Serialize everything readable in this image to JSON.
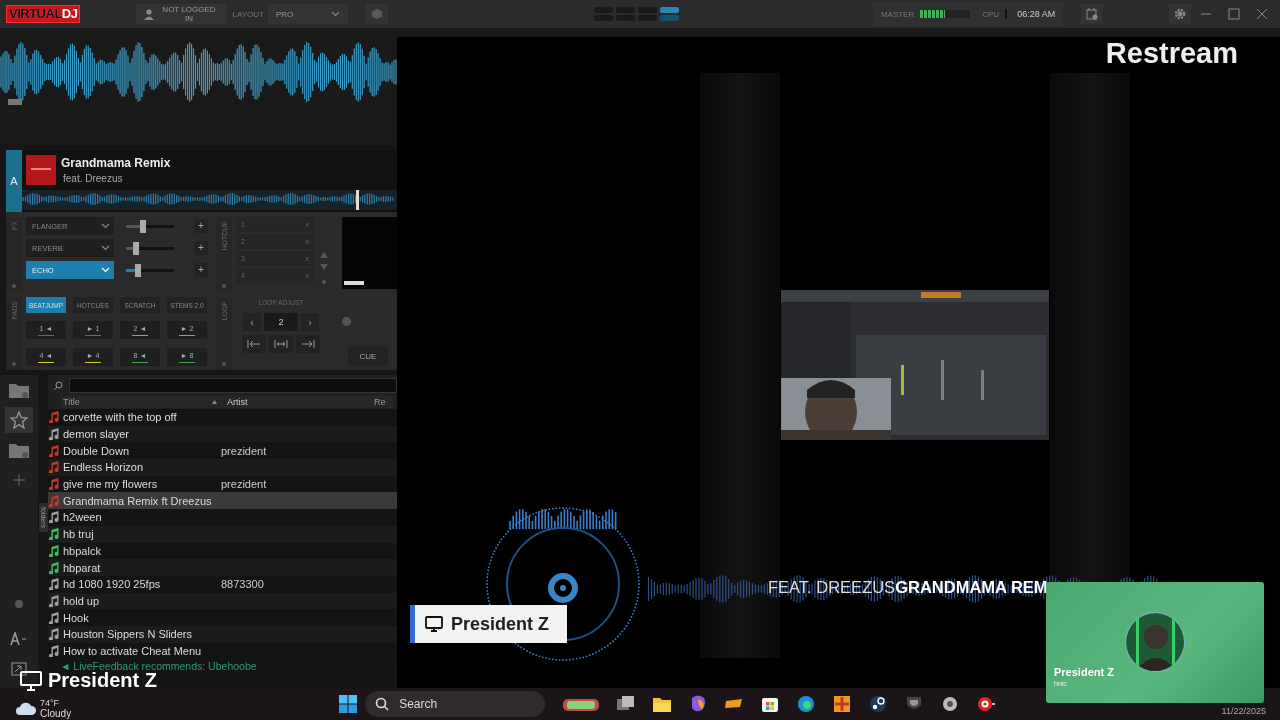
{
  "title_bar": {
    "logo": [
      "VIRTUAL",
      "DJ"
    ],
    "user": "NOT LOGGED IN",
    "layout_label": "LAYOUT",
    "layout_value": "PRO",
    "master_label": "MASTER",
    "master_meter": {
      "level": 0.5
    },
    "cpu_label": "CPU",
    "clock": "06:28 AM"
  },
  "layout_presets": [
    {
      "selected": false
    },
    {
      "selected": false
    },
    {
      "selected": false
    },
    {
      "selected": true
    }
  ],
  "deck": {
    "letter": "A",
    "title": "Grandmama Remix",
    "artist": "feat. Dreezus",
    "playhead": {
      "level": 0.89
    },
    "fx_label": "FX",
    "effects": [
      {
        "name": "FLANGER",
        "selected": false,
        "level": 0.35,
        "add": "+"
      },
      {
        "name": "REVERB",
        "selected": false,
        "level": 0.2,
        "add": "+"
      },
      {
        "name": "ECHO",
        "selected": true,
        "level": 0.25,
        "add": "+"
      }
    ],
    "hotcue_label": "HOTCUE",
    "hotcues": [
      {
        "number": "1",
        "clear": "x"
      },
      {
        "number": "2",
        "clear": "x"
      },
      {
        "number": "3",
        "clear": "x"
      },
      {
        "number": "4",
        "clear": "x"
      }
    ],
    "pads_label": "PADS",
    "pad_modes": [
      {
        "label": "BEATJUMP",
        "selected": true
      },
      {
        "label": "HOTCUES",
        "selected": false
      },
      {
        "label": "SCRATCH",
        "selected": false
      },
      {
        "label": "STEMS 2.0",
        "selected": false
      }
    ],
    "pads": [
      {
        "label": "1 ◄",
        "color": "#d83a3a"
      },
      {
        "label": "► 1",
        "color": "#d83a3a"
      },
      {
        "label": "2 ◄",
        "color": "#e0882a"
      },
      {
        "label": "► 2",
        "color": "#e0882a"
      },
      {
        "label": "4 ◄",
        "color": "#d8c43a"
      },
      {
        "label": "► 4",
        "color": "#d8c43a"
      },
      {
        "label": "8 ◄",
        "color": "#3aa84a"
      },
      {
        "label": "► 8",
        "color": "#3aa84a"
      }
    ],
    "loop_label": "LOOP",
    "loop_adjust": "LOOP ADJUST",
    "loop_prev": "‹",
    "loop_size": "2",
    "loop_next": "›",
    "cue": "CUE"
  },
  "browser": {
    "folders_tab": "folders",
    "columns": [
      "Title",
      "Artist"
    ],
    "column_3": "Re",
    "rows": [
      {
        "title": "corvette with the top off",
        "color": "#c0392b",
        "selected": false
      },
      {
        "title": "demon slayer",
        "color": "#a0a0a0",
        "selected": false
      },
      {
        "title": "Double Down",
        "artist": "prezident",
        "color": "#c0392b",
        "selected": false
      },
      {
        "title": "Endless Horizon",
        "color": "#c0392b",
        "selected": false
      },
      {
        "title": "give me my flowers",
        "artist": "prezident",
        "color": "#c0392b",
        "selected": false
      },
      {
        "title": "Grandmama Remix ft Dreezus",
        "color": "#c0392b",
        "selected": true
      },
      {
        "title": "h2ween",
        "color": "#a0a0a0",
        "selected": false
      },
      {
        "title": "hb truj",
        "color": "#3fbf5f",
        "selected": false
      },
      {
        "title": "hbpalck",
        "color": "#3fbf5f",
        "selected": false
      },
      {
        "title": "hbparat",
        "color": "#3fbf5f",
        "selected": false
      },
      {
        "title": "hd 1080 1920 25fps",
        "artist": "8873300",
        "color": "#a0a0a0",
        "selected": false
      },
      {
        "title": "hold up",
        "color": "#a0a0a0",
        "selected": false
      },
      {
        "title": "Hook",
        "color": "#a0a0a0",
        "selected": false
      },
      {
        "title": "Houston Sippers N Sliders",
        "color": "#a0a0a0",
        "selected": false
      },
      {
        "title": "How to activate Cheat Menu",
        "color": "#a0a0a0",
        "selected": false
      }
    ],
    "feedback": "◄ LiveFeedback recommends: Ubehoobe"
  },
  "stream": {
    "brand": "Restream",
    "name_tag": "President Z",
    "feat": "FEAT. DREEZUS",
    "song": "GRANDMAMA REM",
    "guest": {
      "name": "President Z",
      "subtitle": "hnic"
    }
  },
  "screen_label": "President Z",
  "taskbar": {
    "temperature": "74°F",
    "weather": "Cloudy",
    "search_placeholder": "Search",
    "date": "11/22/2025"
  }
}
